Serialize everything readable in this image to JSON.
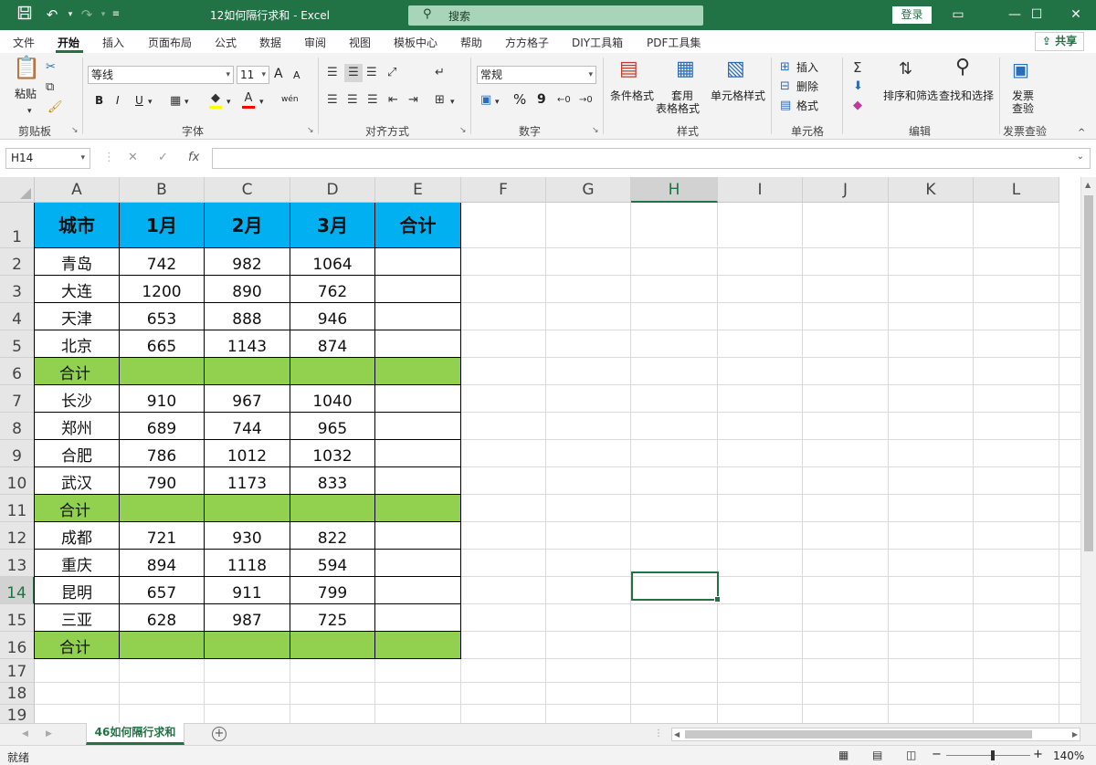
{
  "titlebar": {
    "doc_title": "12如何隔行求和  -  Excel",
    "search_placeholder": "搜索",
    "login_label": "登录",
    "icons": [
      "save-icon",
      "undo-icon",
      "redo-icon",
      "customize-icon",
      "ribbon-display-icon",
      "minimize-icon",
      "maximize-icon",
      "close-icon"
    ]
  },
  "menu": {
    "items": [
      "文件",
      "开始",
      "插入",
      "页面布局",
      "公式",
      "数据",
      "审阅",
      "视图",
      "模板中心",
      "帮助",
      "方方格子",
      "DIY工具箱",
      "PDF工具集"
    ],
    "active": "开始",
    "share_label": "共享"
  },
  "ribbon": {
    "clipboard": {
      "paste_label": "粘贴",
      "group_label": "剪贴板"
    },
    "font": {
      "font_name": "等线",
      "font_size": "11",
      "group_label": "字体",
      "bold": "B",
      "italic": "I",
      "underline": "U",
      "grow": "A",
      "shrink": "A",
      "phonetic": "wén",
      "font_color": "#ff0000",
      "fill_color": "#ffff00"
    },
    "alignment": {
      "group_label": "对齐方式"
    },
    "number": {
      "format": "常规",
      "group_label": "数字",
      "percent": "%",
      "comma": "9"
    },
    "styles": {
      "conditional_label": "条件格式",
      "table_label_1": "套用",
      "table_label_2": "表格格式",
      "cell_style_label": "单元格样式",
      "group_label": "样式"
    },
    "cells": {
      "insert_label": "插入",
      "delete_label": "删除",
      "format_label": "格式",
      "group_label": "单元格"
    },
    "editing": {
      "sort_label": "排序和筛选",
      "find_label": "查找和选择",
      "group_label": "编辑"
    },
    "invoice": {
      "label_1": "发票",
      "label_2": "查验",
      "group_label": "发票查验"
    }
  },
  "formula_bar": {
    "name_box": "H14",
    "cancel": "✕",
    "enter": "✓",
    "fx": "fx",
    "content": ""
  },
  "sheet": {
    "columns": [
      "A",
      "B",
      "C",
      "D",
      "E",
      "F",
      "G",
      "H",
      "I",
      "J",
      "K",
      "L"
    ],
    "selected_column": "H",
    "selected_row": "14",
    "rows": [
      "1",
      "2",
      "3",
      "4",
      "5",
      "6",
      "7",
      "8",
      "9",
      "10",
      "11",
      "12",
      "13",
      "14",
      "15",
      "16",
      "17",
      "18",
      "19"
    ],
    "header": [
      "城市",
      "1月",
      "2月",
      "3月",
      "合计"
    ],
    "data": [
      [
        "青岛",
        "742",
        "982",
        "1064",
        ""
      ],
      [
        "大连",
        "1200",
        "890",
        "762",
        ""
      ],
      [
        "天津",
        "653",
        "888",
        "946",
        ""
      ],
      [
        "北京",
        "665",
        "1143",
        "874",
        ""
      ],
      [
        "合计",
        "",
        "",
        "",
        ""
      ],
      [
        "长沙",
        "910",
        "967",
        "1040",
        ""
      ],
      [
        "郑州",
        "689",
        "744",
        "965",
        ""
      ],
      [
        "合肥",
        "786",
        "1012",
        "1032",
        ""
      ],
      [
        "武汉",
        "790",
        "1173",
        "833",
        ""
      ],
      [
        "合计",
        "",
        "",
        "",
        ""
      ],
      [
        "成都",
        "721",
        "930",
        "822",
        ""
      ],
      [
        "重庆",
        "894",
        "1118",
        "594",
        ""
      ],
      [
        "昆明",
        "657",
        "911",
        "799",
        ""
      ],
      [
        "三亚",
        "628",
        "987",
        "725",
        ""
      ],
      [
        "合计",
        "",
        "",
        "",
        ""
      ]
    ],
    "colors": {
      "header_fill": "#00b0f0",
      "total_fill": "#92d050",
      "accent": "#217346"
    }
  },
  "tabs": {
    "sheet_name": "46如何隔行求和",
    "add_label": "+"
  },
  "status": {
    "ready": "就绪",
    "zoom": "140%",
    "zoom_minus": "−",
    "zoom_plus": "+"
  }
}
